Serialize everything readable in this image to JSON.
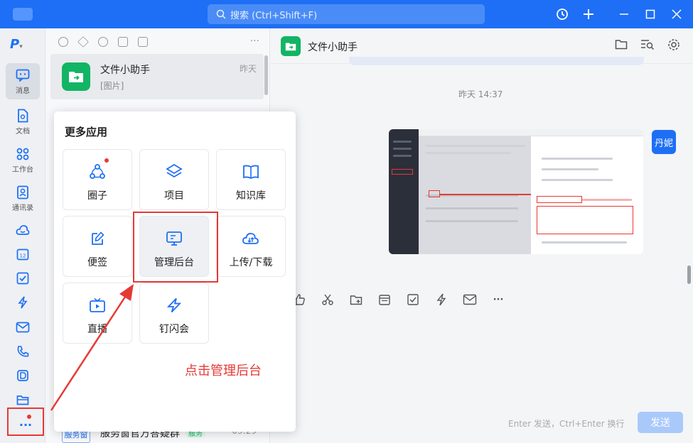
{
  "app": {
    "search_placeholder": "搜索 (Ctrl+Shift+F)"
  },
  "rail": {
    "items": [
      {
        "label": "消息",
        "icon": "chat-icon"
      },
      {
        "label": "文档",
        "icon": "document-icon"
      },
      {
        "label": "工作台",
        "icon": "grid-icon"
      },
      {
        "label": "通讯录",
        "icon": "contacts-icon"
      },
      {
        "label": "",
        "icon": "cloud-icon"
      },
      {
        "label": "",
        "icon": "calendar-icon"
      },
      {
        "label": "",
        "icon": "check-icon"
      },
      {
        "label": "",
        "icon": "lightning-icon"
      },
      {
        "label": "",
        "icon": "mail-icon"
      },
      {
        "label": "",
        "icon": "phone-icon"
      },
      {
        "label": "",
        "icon": "doc-edit-icon"
      },
      {
        "label": "",
        "icon": "folder-icon"
      }
    ],
    "more": "..."
  },
  "conversations": [
    {
      "name": "文件小助手",
      "preview": "[图片]",
      "time": "昨天"
    },
    {
      "name": "服务窗官方答疑群",
      "preview": "",
      "time": "09:29",
      "badge": "服务",
      "avatar_text": "服务窗"
    }
  ],
  "popup": {
    "title": "更多应用",
    "apps": [
      {
        "label": "圈子",
        "icon": "circle-group-icon",
        "dot": true
      },
      {
        "label": "项目",
        "icon": "project-icon",
        "dot": false
      },
      {
        "label": "知识库",
        "icon": "book-icon",
        "dot": false
      },
      {
        "label": "便签",
        "icon": "note-icon",
        "dot": false
      },
      {
        "label": "管理后台",
        "icon": "admin-monitor-icon",
        "dot": false
      },
      {
        "label": "上传/下载",
        "icon": "upload-download-icon",
        "dot": false
      },
      {
        "label": "直播",
        "icon": "tv-icon",
        "dot": false
      },
      {
        "label": "钉闪会",
        "icon": "flash-meeting-icon",
        "dot": false
      }
    ]
  },
  "annotation": "点击管理后台",
  "chat": {
    "title": "文件小助手",
    "time_separator": "昨天 14:37",
    "sender": "丹妮",
    "input_hint": "Enter 发送，Ctrl+Enter 换行",
    "send_label": "发送"
  },
  "colors": {
    "brand": "#1e6ff5",
    "green": "#12b564",
    "red": "#e53935"
  }
}
